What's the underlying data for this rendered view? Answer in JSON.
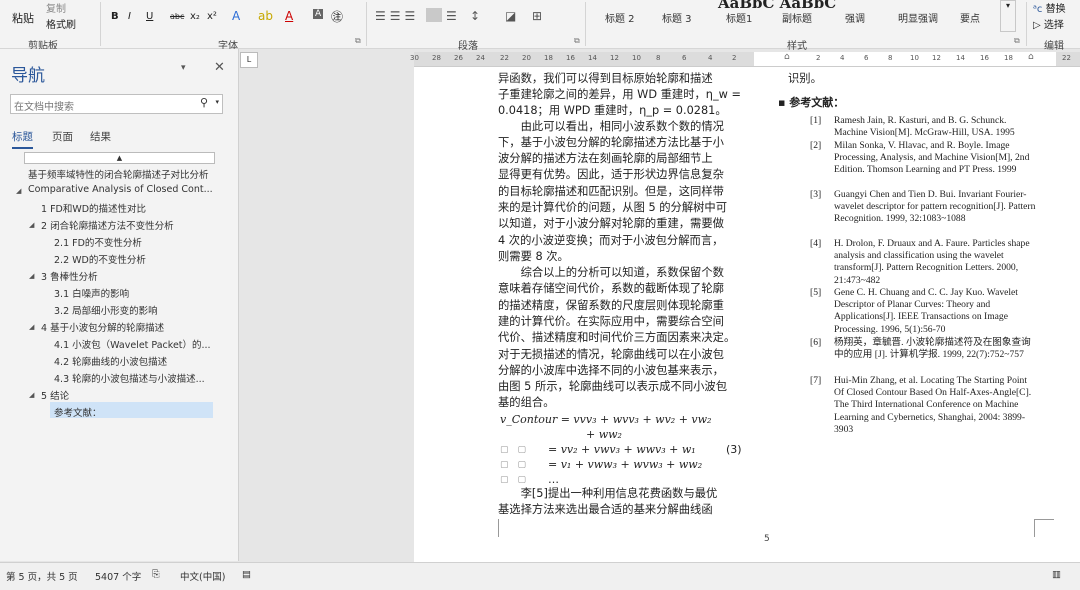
{
  "ribbon": {
    "clipboard": {
      "paste": "粘贴",
      "copy": "复制",
      "format_painter": "格式刷",
      "label": "剪贴板"
    },
    "font": {
      "bold": "B",
      "italic": "I",
      "underline": "U",
      "strike": "abc",
      "sub": "x₂",
      "sup": "x²",
      "label": "字体"
    },
    "paragraph": {
      "label": "段落"
    },
    "styles": {
      "big_preview": "AaBbC AaBbC",
      "items": [
        "标题 2",
        "标题 3",
        "标题1",
        "副标题",
        "强调",
        "明显强调",
        "要点"
      ],
      "label": "样式"
    },
    "editing": {
      "replace": "替换",
      "select": "选择",
      "label": "编辑"
    }
  },
  "nav": {
    "title": "导航",
    "search_placeholder": "在文档中搜索",
    "tabs": [
      "标题",
      "页面",
      "结果"
    ],
    "tree": [
      "基于频率域特性的闭合轮廓描述子对比分析",
      "Comparative Analysis of Closed Cont...",
      "1 FD和WD的描述性对比",
      "2 闭合轮廓描述方法不变性分析",
      "2.1 FD的不变性分析",
      "2.2 WD的不变性分析",
      "3 鲁棒性分析",
      "3.1 白噪声的影响",
      "3.2 局部细小形变的影响",
      "4 基于小波包分解的轮廓描述",
      "4.1 小波包（Wavelet Packet）的...",
      "4.2 轮廓曲线的小波包描述",
      "4.3 轮廓的小波包描述与小波描述...",
      "5 结论",
      "参考文献："
    ]
  },
  "ruler": {
    "ticks": [
      "30",
      "28",
      "26",
      "24",
      "22",
      "20",
      "18",
      "16",
      "14",
      "12",
      "10",
      "8",
      "6",
      "4",
      "2",
      "2",
      "4",
      "6",
      "8",
      "10",
      "12",
      "14",
      "16",
      "18",
      "22"
    ]
  },
  "document": {
    "left_col": [
      "异函数，我们可以得到目标原始轮廓和描述",
      "子重建轮廓之间的差异，用 WD 重建时，η_w =",
      "0.0418；用 WPD 重建时，η_p = 0.0281。",
      "　　由此可以看出，相同小波系数个数的情况",
      "下，基于小波包分解的轮廓描述方法比基于小",
      "波分解的描述方法在刻画轮廓的局部细节上",
      "显得更有优势。因此，适于形状边界信息复杂",
      "的目标轮廓描述和匹配识别。但是，这同样带",
      "来的是计算代价的问题，从图 5 的分解树中可",
      "以知道，对于小波分解对轮廓的重建，需要做",
      "4 次的小波逆变换；而对于小波包分解而言，",
      "则需要 8 次。",
      "　　综合以上的分析可以知道，系数保留个数",
      "意味着存储空间代价，系数的截断体现了轮廓",
      "的描述精度，保留系数的尺度层则体现轮廓重",
      "建的计算代价。在实际应用中，需要综合空间",
      "代价、描述精度和时间代价三方面因素来决定。",
      "对于无损描述的情况，轮廓曲线可以在小波包",
      "分解的小波库中选择不同的小波包基来表示，",
      "由图 5 所示，轮廓曲线可以表示成不同小波包",
      "基的组合。"
    ],
    "eq_line1": "v_Contour = vvv₃ + wvv₃ + wv₂ + vw₂",
    "eq_line2": "+ ww₂",
    "eq_line3": "= vv₂ + vwv₃ + wwv₃ + w₁",
    "eq_line4": "= v₁ + vww₃ + wvw₃ + ww₂",
    "eq_line5": "…",
    "eq_num": "(3)",
    "left_tail": [
      "　　李[5]提出一种利用信息花费函数与最优",
      "基选择方法来选出最合适的基来分解曲线函"
    ],
    "right_top": "识别。",
    "refs_title": "参考文献：",
    "refs": [
      {
        "n": "[1]",
        "t": "Ramesh Jain, R. Kasturi, and B. G. Schunck. Machine Vision[M]. McGraw-Hill, USA. 1995"
      },
      {
        "n": "[2]",
        "t": "Milan Sonka, V. Hlavac, and R. Boyle. Image Processing, Analysis, and Machine Vision[M], 2nd Edition. Thomson Learning and PT Press. 1999"
      },
      {
        "n": "[3]",
        "t": "Guangyi Chen and Tien D. Bui. Invariant Fourier-wavelet descriptor for pattern recognition[J]. Pattern Recognition. 1999, 32:1083~1088"
      },
      {
        "n": "[4]",
        "t": "H. Drolon, F. Druaux and A. Faure. Particles shape analysis and classification using the wavelet transform[J]. Pattern Recognition Letters. 2000, 21:473~482"
      },
      {
        "n": "[5]",
        "t": "Gene C. H. Chuang and C. C. Jay Kuo. Wavelet Descriptor of Planar Curves: Theory and Applications[J]. IEEE Transactions on Image Processing. 1996, 5(1):56-70"
      },
      {
        "n": "[6]",
        "t": "杨翔英，章毓晋. 小波轮廓描述符及在图象查询中的应用 [J]. 计算机学报. 1999, 22(7):752~757"
      },
      {
        "n": "[7]",
        "t": "Hui-Min Zhang, et al. Locating The Starting Point Of Closed Contour Based On Half-Axes-Angle[C]. The Third International Conference on Machine Learning and Cybernetics, Shanghai, 2004: 3899-3903"
      }
    ],
    "page_number": "5"
  },
  "status": {
    "page": "第 5 页，共 5 页",
    "words": "5407 个字",
    "lang": "中文(中国)"
  }
}
